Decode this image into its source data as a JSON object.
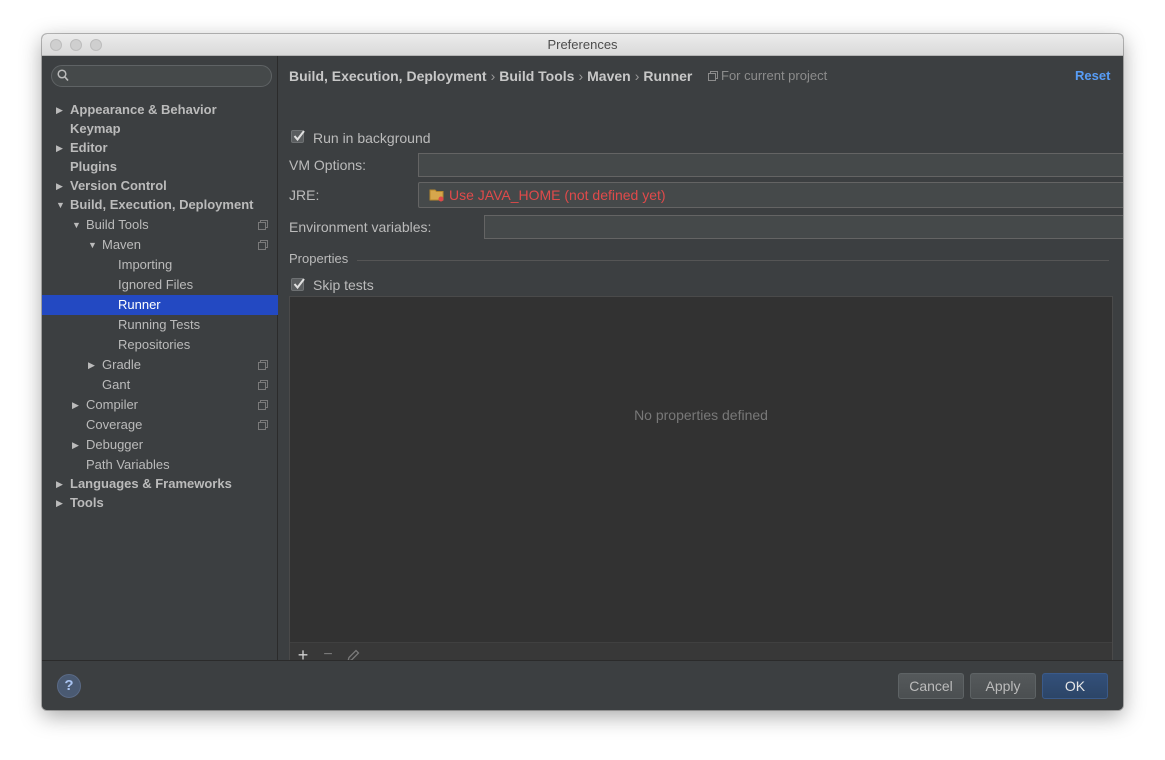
{
  "window": {
    "title": "Preferences"
  },
  "search": {
    "placeholder": ""
  },
  "sidebar": {
    "items": [
      {
        "label": "Appearance & Behavior",
        "bold": true,
        "level": 0,
        "arrow": "right",
        "selected": false,
        "project": false
      },
      {
        "label": "Keymap",
        "bold": true,
        "level": 0,
        "arrow": "none",
        "selected": false,
        "project": false
      },
      {
        "label": "Editor",
        "bold": true,
        "level": 0,
        "arrow": "right",
        "selected": false,
        "project": false
      },
      {
        "label": "Plugins",
        "bold": true,
        "level": 0,
        "arrow": "none",
        "selected": false,
        "project": false
      },
      {
        "label": "Version Control",
        "bold": true,
        "level": 0,
        "arrow": "right",
        "selected": false,
        "project": false
      },
      {
        "label": "Build, Execution, Deployment",
        "bold": true,
        "level": 0,
        "arrow": "down",
        "selected": false,
        "project": false
      },
      {
        "label": "Build Tools",
        "bold": false,
        "level": 1,
        "arrow": "down",
        "selected": false,
        "project": true
      },
      {
        "label": "Maven",
        "bold": false,
        "level": 2,
        "arrow": "down",
        "selected": false,
        "project": true
      },
      {
        "label": "Importing",
        "bold": false,
        "level": 3,
        "arrow": "none",
        "selected": false,
        "project": false
      },
      {
        "label": "Ignored Files",
        "bold": false,
        "level": 3,
        "arrow": "none",
        "selected": false,
        "project": false
      },
      {
        "label": "Runner",
        "bold": false,
        "level": 3,
        "arrow": "none",
        "selected": true,
        "project": false
      },
      {
        "label": "Running Tests",
        "bold": false,
        "level": 3,
        "arrow": "none",
        "selected": false,
        "project": false
      },
      {
        "label": "Repositories",
        "bold": false,
        "level": 3,
        "arrow": "none",
        "selected": false,
        "project": false
      },
      {
        "label": "Gradle",
        "bold": false,
        "level": 2,
        "arrow": "right",
        "selected": false,
        "project": true
      },
      {
        "label": "Gant",
        "bold": false,
        "level": 2,
        "arrow": "none",
        "selected": false,
        "project": true
      },
      {
        "label": "Compiler",
        "bold": false,
        "level": 1,
        "arrow": "right",
        "selected": false,
        "project": true
      },
      {
        "label": "Coverage",
        "bold": false,
        "level": 1,
        "arrow": "none",
        "selected": false,
        "project": true
      },
      {
        "label": "Debugger",
        "bold": false,
        "level": 1,
        "arrow": "right",
        "selected": false,
        "project": false
      },
      {
        "label": "Path Variables",
        "bold": false,
        "level": 1,
        "arrow": "none",
        "selected": false,
        "project": false
      },
      {
        "label": "Languages & Frameworks",
        "bold": true,
        "level": 0,
        "arrow": "right",
        "selected": false,
        "project": false
      },
      {
        "label": "Tools",
        "bold": true,
        "level": 0,
        "arrow": "right",
        "selected": false,
        "project": false
      }
    ]
  },
  "breadcrumb": {
    "parts": [
      "Build, Execution, Deployment",
      "Build Tools",
      "Maven",
      "Runner"
    ],
    "separator": "›",
    "scope": "For current project"
  },
  "header": {
    "reset_label": "Reset"
  },
  "form": {
    "run_in_background": {
      "label": "Run in background",
      "checked": true
    },
    "vm_options": {
      "label": "VM Options:",
      "value": ""
    },
    "jre": {
      "label": "JRE:",
      "value": "Use JAVA_HOME (not defined yet)"
    },
    "env_vars": {
      "label": "Environment variables:",
      "value": "",
      "button_label": "..."
    },
    "properties_title": "Properties",
    "skip_tests": {
      "label": "Skip tests",
      "checked": true
    },
    "properties_empty": "No properties defined",
    "toolbar": {
      "add": "+",
      "remove": "−"
    }
  },
  "footer": {
    "help_label": "?",
    "cancel_label": "Cancel",
    "apply_label": "Apply",
    "ok_label": "OK"
  },
  "colors": {
    "accent": "#589df6",
    "selection": "#2349c2",
    "error": "#e04a4a",
    "background": "#3c3f41"
  }
}
